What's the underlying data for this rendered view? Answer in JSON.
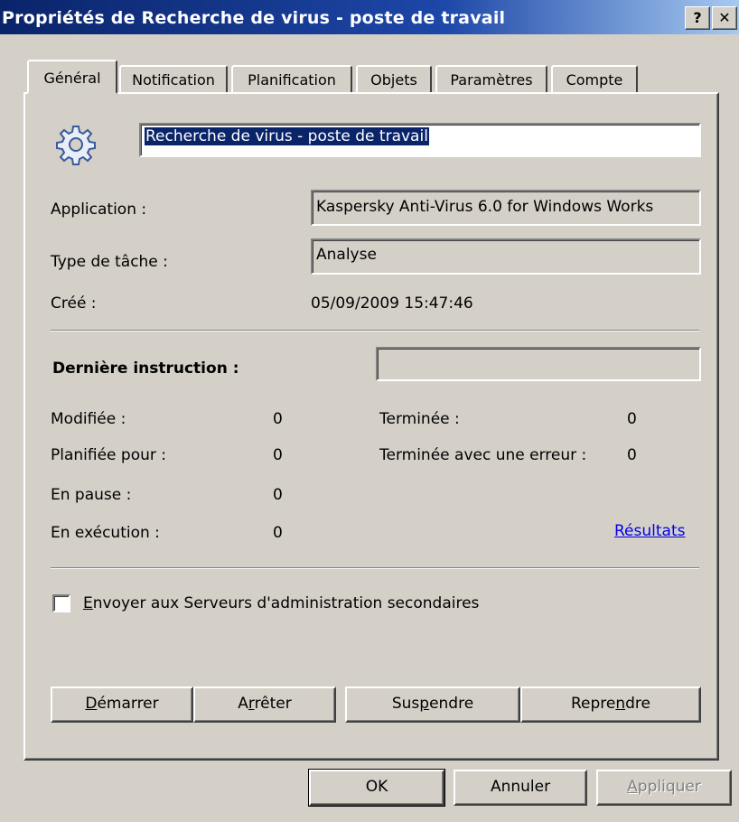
{
  "window": {
    "title": "Propriétés de Recherche de virus - poste de travail",
    "help_label": "?",
    "close_label": "✕"
  },
  "tabs": [
    {
      "label": "Général",
      "active": true
    },
    {
      "label": "Notification"
    },
    {
      "label": "Planification"
    },
    {
      "label": "Objets"
    },
    {
      "label": "Paramètres"
    },
    {
      "label": "Compte"
    }
  ],
  "general": {
    "task_name": "Recherche de virus - poste de travail",
    "application_label": "Application :",
    "application_value": "Kaspersky Anti-Virus 6.0 for Windows Works",
    "task_type_label": "Type de tâche :",
    "task_type_value": "Analyse",
    "created_label": "Créé :",
    "created_value": "05/09/2009 15:47:46",
    "last_instruction_label": "Dernière instruction :",
    "last_instruction_value": ""
  },
  "stats": {
    "modified": {
      "label": "Modifiée :",
      "value": "0"
    },
    "planned": {
      "label": "Planifiée pour :",
      "value": "0"
    },
    "paused": {
      "label": "En pause :",
      "value": "0"
    },
    "running": {
      "label": "En exécution :",
      "value": "0"
    },
    "finished": {
      "label": "Terminée :",
      "value": "0"
    },
    "finished_error": {
      "label": "Terminée avec une erreur :",
      "value": "0"
    },
    "results_link": "Résultats"
  },
  "send_secondary": {
    "checked": false,
    "underline": "E",
    "label_rest": "nvoyer aux Serveurs d'administration secondaires"
  },
  "actions": {
    "start": {
      "before": "",
      "u": "D",
      "after": "émarrer"
    },
    "stop": {
      "before": "A",
      "u": "r",
      "after": "rêter"
    },
    "suspend": {
      "before": "Sus",
      "u": "p",
      "after": "endre"
    },
    "resume": {
      "before": "Repre",
      "u": "n",
      "after": "dre"
    }
  },
  "footer": {
    "ok": "OK",
    "cancel": "Annuler",
    "apply": {
      "u": "A",
      "after": "ppliquer"
    }
  },
  "colors": {
    "title_start": "#0a246a",
    "title_end": "#a6caf0",
    "link": "#0000ee",
    "selection": "#0a246a"
  }
}
